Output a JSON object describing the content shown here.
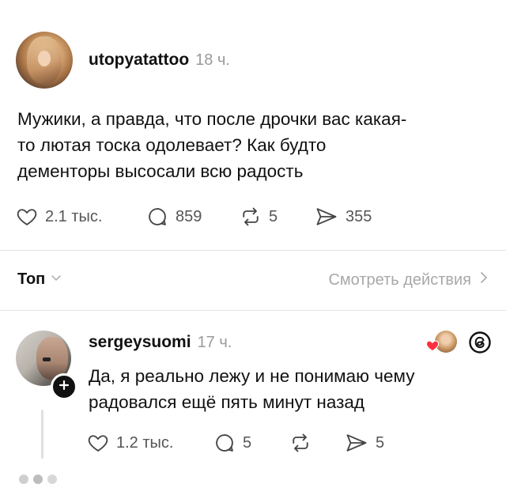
{
  "post": {
    "username": "utopyatattoo",
    "time": "18 ч.",
    "text_lines": [
      "Мужики, а правда, что после дрочки вас какая-",
      "то лютая тоска одолевает? Как будто",
      "дементоры высосали всю радость"
    ],
    "likes": "2.1 тыс.",
    "replies": "859",
    "reposts": "5",
    "shares": "355"
  },
  "sort_bar": {
    "sort_label": "Топ",
    "view_activity": "Смотреть действия"
  },
  "reply": {
    "username": "sergeysuomi",
    "time": "17 ч.",
    "text_lines": [
      "Да, я реально лежу и не понимаю чему",
      "радовался ещё пять минут назад"
    ],
    "likes": "1.2 тыс.",
    "replies": "5",
    "shares": "5"
  },
  "colors": {
    "accent_heart": "#ff3040",
    "muted": "#9a9a9a",
    "icon": "#555555"
  }
}
